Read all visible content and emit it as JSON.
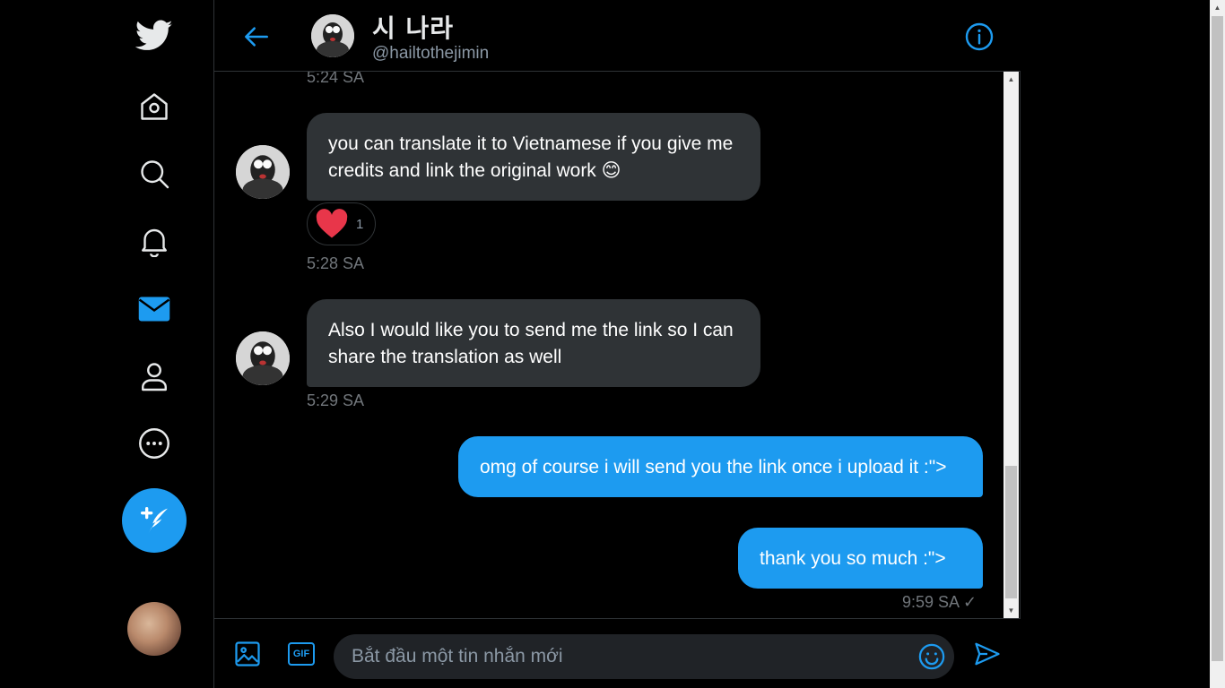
{
  "nav": {
    "items": [
      {
        "name": "twitter-logo-icon"
      },
      {
        "name": "home-icon"
      },
      {
        "name": "explore-search-icon"
      },
      {
        "name": "notifications-bell-icon"
      },
      {
        "name": "messages-mail-icon"
      },
      {
        "name": "profile-person-icon"
      },
      {
        "name": "more-options-icon"
      }
    ],
    "accent": "#1d9bf0"
  },
  "header": {
    "name": "시 나라",
    "handle": "@hailtothejimin"
  },
  "messages": {
    "top_timestamp": "5:24 SA",
    "items": [
      {
        "direction": "in",
        "text": "you can translate it to Vietnamese if you give me credits and link the original work 😊",
        "reaction_count": "1",
        "timestamp": "5:28 SA"
      },
      {
        "direction": "in",
        "text": "Also I would like you to send me the link so I can share the translation as well",
        "timestamp": "5:29 SA"
      },
      {
        "direction": "out",
        "text": "omg of course i will send you the link once i upload it :\">"
      },
      {
        "direction": "out",
        "text": "thank you so much :\">",
        "timestamp": "9:59 SA ✓"
      }
    ]
  },
  "composer": {
    "placeholder": "Bắt đầu một tin nhắn mới",
    "gif_label": "GIF"
  },
  "colors": {
    "incoming_bubble": "#2f3336",
    "outgoing_bubble": "#1d9bf0",
    "timestamp": "#71767b"
  }
}
